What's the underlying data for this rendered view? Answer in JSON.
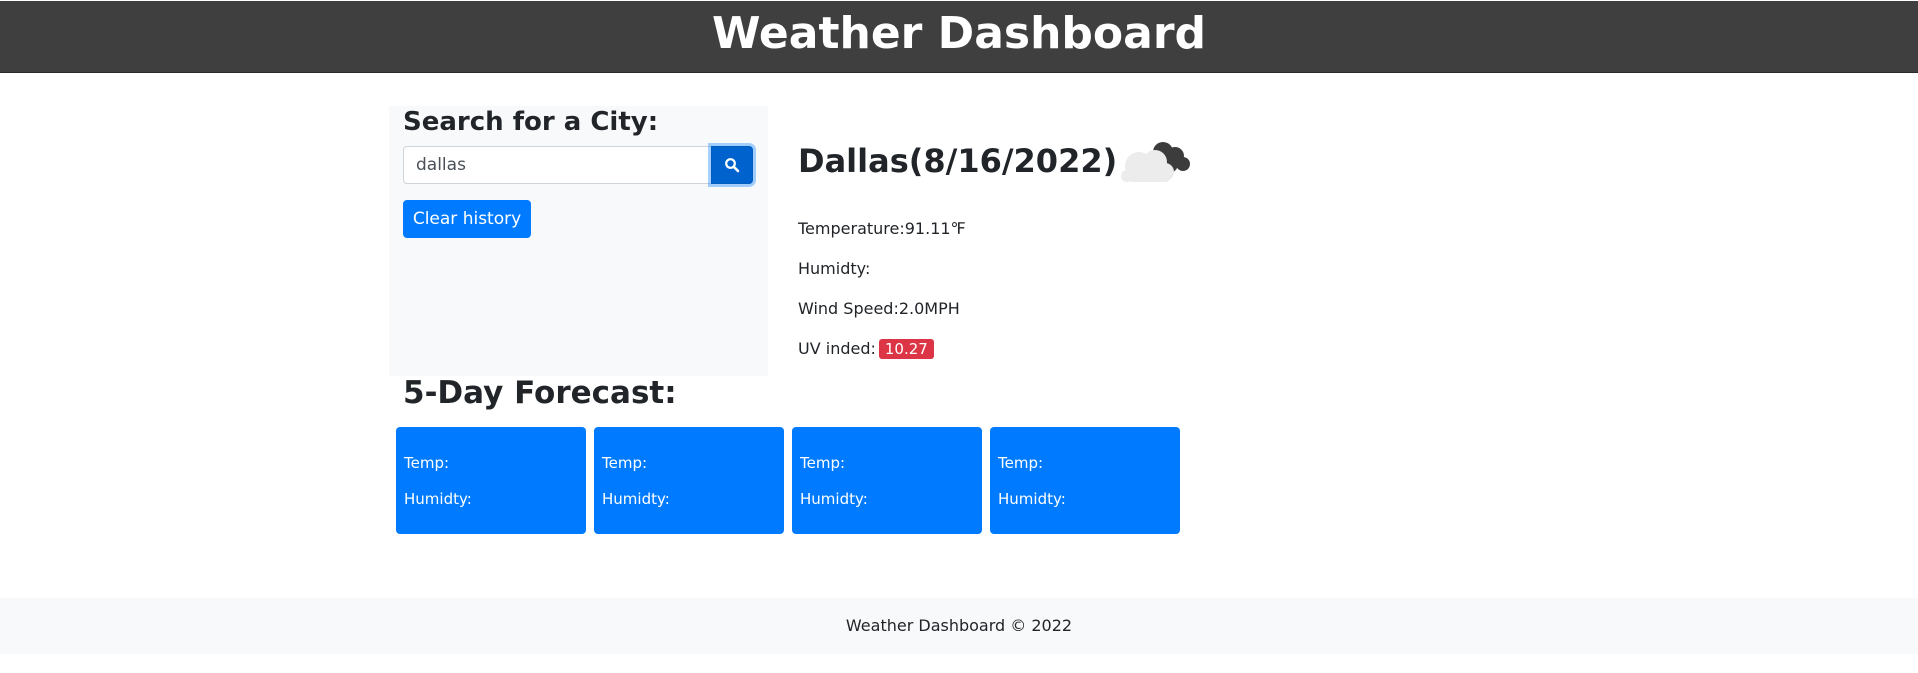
{
  "header": {
    "title": "Weather Dashboard"
  },
  "search": {
    "title": "Search for a City:",
    "input_value": "dallas",
    "search_icon": "search-icon",
    "clear_label": "Clear history"
  },
  "current": {
    "city_date": "Dallas(8/16/2022)",
    "icon": "cloudy-icon",
    "temperature_label": "Temperature:",
    "temperature_value": "91.11℉",
    "humidity_label": "Humidty:",
    "humidity_value": "",
    "wind_label": "Wind Speed:",
    "wind_value": "2.0MPH",
    "uv_label": "UV inded:",
    "uv_value": "10.27",
    "uv_color": "#dc3545"
  },
  "forecast": {
    "title": "5-Day Forecast:",
    "card_color": "#007bff",
    "cards": [
      {
        "temp": "Temp:",
        "humidity": "Humidty:"
      },
      {
        "temp": "Temp:",
        "humidity": "Humidty:"
      },
      {
        "temp": "Temp:",
        "humidity": "Humidty:"
      },
      {
        "temp": "Temp:",
        "humidity": "Humidty:"
      }
    ]
  },
  "footer": {
    "text": "Weather Dashboard © 2022"
  }
}
